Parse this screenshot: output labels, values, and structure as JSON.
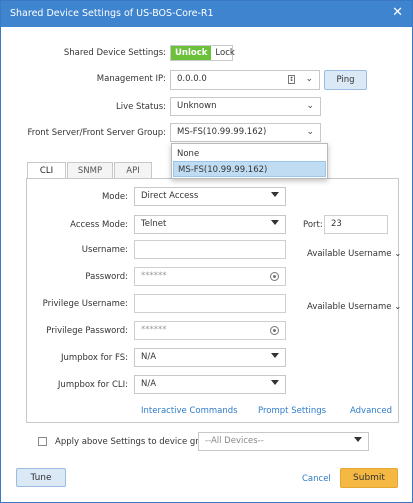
{
  "window": {
    "title": "Shared Device Settings of US-BOS-Core-R1",
    "close_glyph": "✕"
  },
  "shared_settings": {
    "label": "Shared Device Settings:",
    "unlock": "Unlock",
    "lock": "Lock"
  },
  "management_ip": {
    "label": "Management IP:",
    "value": "0.0.0.0",
    "ping": "Ping"
  },
  "live_status": {
    "label": "Live Status:",
    "value": "Unknown"
  },
  "front_server": {
    "label": "Front Server/Front Server Group:",
    "value": "MS-FS(10.99.99.162)",
    "options": [
      "None",
      "MS-FS(10.99.99.162)"
    ]
  },
  "tabs": [
    "CLI",
    "SNMP",
    "API"
  ],
  "cli": {
    "mode_label": "Mode:",
    "mode_value": "Direct Access",
    "access_mode_label": "Access Mode:",
    "access_mode_value": "Telnet",
    "port_label": "Port:",
    "port_value": "23",
    "username_label": "Username:",
    "available_username": "Available Username",
    "password_label": "Password:",
    "password_value": "******",
    "priv_username_label": "Privilege Username:",
    "priv_password_label": "Privilege Password:",
    "priv_password_value": "******",
    "jumpbox_fs_label": "Jumpbox for FS:",
    "jumpbox_fs_value": "N/A",
    "jumpbox_cli_label": "Jumpbox for CLI:",
    "jumpbox_cli_value": "N/A",
    "links": [
      "Interactive Commands",
      "Prompt Settings",
      "Advanced"
    ]
  },
  "apply": {
    "label": "Apply above Settings to device group:",
    "placeholder": "--All Devices--"
  },
  "footer": {
    "tune": "Tune",
    "cancel": "Cancel",
    "submit": "Submit"
  },
  "colors": {
    "title_bar": "#3f84cf",
    "unlock": "#6bc13a",
    "link": "#2f7bc9",
    "submit": "#f5b943"
  }
}
